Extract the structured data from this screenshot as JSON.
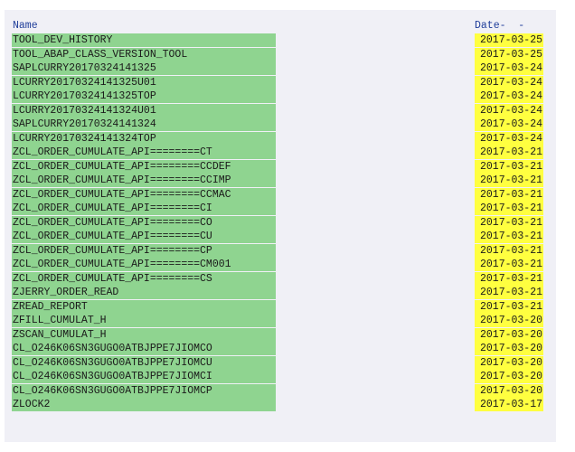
{
  "header": {
    "name_label": "Name",
    "date_label": "Date-  -"
  },
  "colors": {
    "name_cell_bg": "#8fd490",
    "date_cell_bg": "#ffff40",
    "header_text": "#1f3d9a",
    "panel_bg": "#f0f0f6"
  },
  "rows": [
    {
      "name": "TOOL_DEV_HISTORY",
      "date": "2017-03-25"
    },
    {
      "name": "TOOL_ABAP_CLASS_VERSION_TOOL",
      "date": "2017-03-25"
    },
    {
      "name": "SAPLCURRY20170324141325",
      "date": "2017-03-24"
    },
    {
      "name": "LCURRY20170324141325U01",
      "date": "2017-03-24"
    },
    {
      "name": "LCURRY20170324141325TOP",
      "date": "2017-03-24"
    },
    {
      "name": "LCURRY20170324141324U01",
      "date": "2017-03-24"
    },
    {
      "name": "SAPLCURRY20170324141324",
      "date": "2017-03-24"
    },
    {
      "name": "LCURRY20170324141324TOP",
      "date": "2017-03-24"
    },
    {
      "name": "ZCL_ORDER_CUMULATE_API========CT",
      "date": "2017-03-21"
    },
    {
      "name": "ZCL_ORDER_CUMULATE_API========CCDEF",
      "date": "2017-03-21"
    },
    {
      "name": "ZCL_ORDER_CUMULATE_API========CCIMP",
      "date": "2017-03-21"
    },
    {
      "name": "ZCL_ORDER_CUMULATE_API========CCMAC",
      "date": "2017-03-21"
    },
    {
      "name": "ZCL_ORDER_CUMULATE_API========CI",
      "date": "2017-03-21"
    },
    {
      "name": "ZCL_ORDER_CUMULATE_API========CO",
      "date": "2017-03-21"
    },
    {
      "name": "ZCL_ORDER_CUMULATE_API========CU",
      "date": "2017-03-21"
    },
    {
      "name": "ZCL_ORDER_CUMULATE_API========CP",
      "date": "2017-03-21"
    },
    {
      "name": "ZCL_ORDER_CUMULATE_API========CM001",
      "date": "2017-03-21"
    },
    {
      "name": "ZCL_ORDER_CUMULATE_API========CS",
      "date": "2017-03-21"
    },
    {
      "name": "ZJERRY_ORDER_READ",
      "date": "2017-03-21"
    },
    {
      "name": "ZREAD_REPORT",
      "date": "2017-03-21"
    },
    {
      "name": "ZFILL_CUMULAT_H",
      "date": "2017-03-20"
    },
    {
      "name": "ZSCAN_CUMULAT_H",
      "date": "2017-03-20"
    },
    {
      "name": "CL_O246K06SN3GUGO0ATBJPPE7JIOMCO",
      "date": "2017-03-20"
    },
    {
      "name": "CL_O246K06SN3GUGO0ATBJPPE7JIOMCU",
      "date": "2017-03-20"
    },
    {
      "name": "CL_O246K06SN3GUGO0ATBJPPE7JIOMCI",
      "date": "2017-03-20"
    },
    {
      "name": "CL_O246K06SN3GUGO0ATBJPPE7JIOMCP",
      "date": "2017-03-20"
    },
    {
      "name": "ZLOCK2",
      "date": "2017-03-17"
    }
  ]
}
